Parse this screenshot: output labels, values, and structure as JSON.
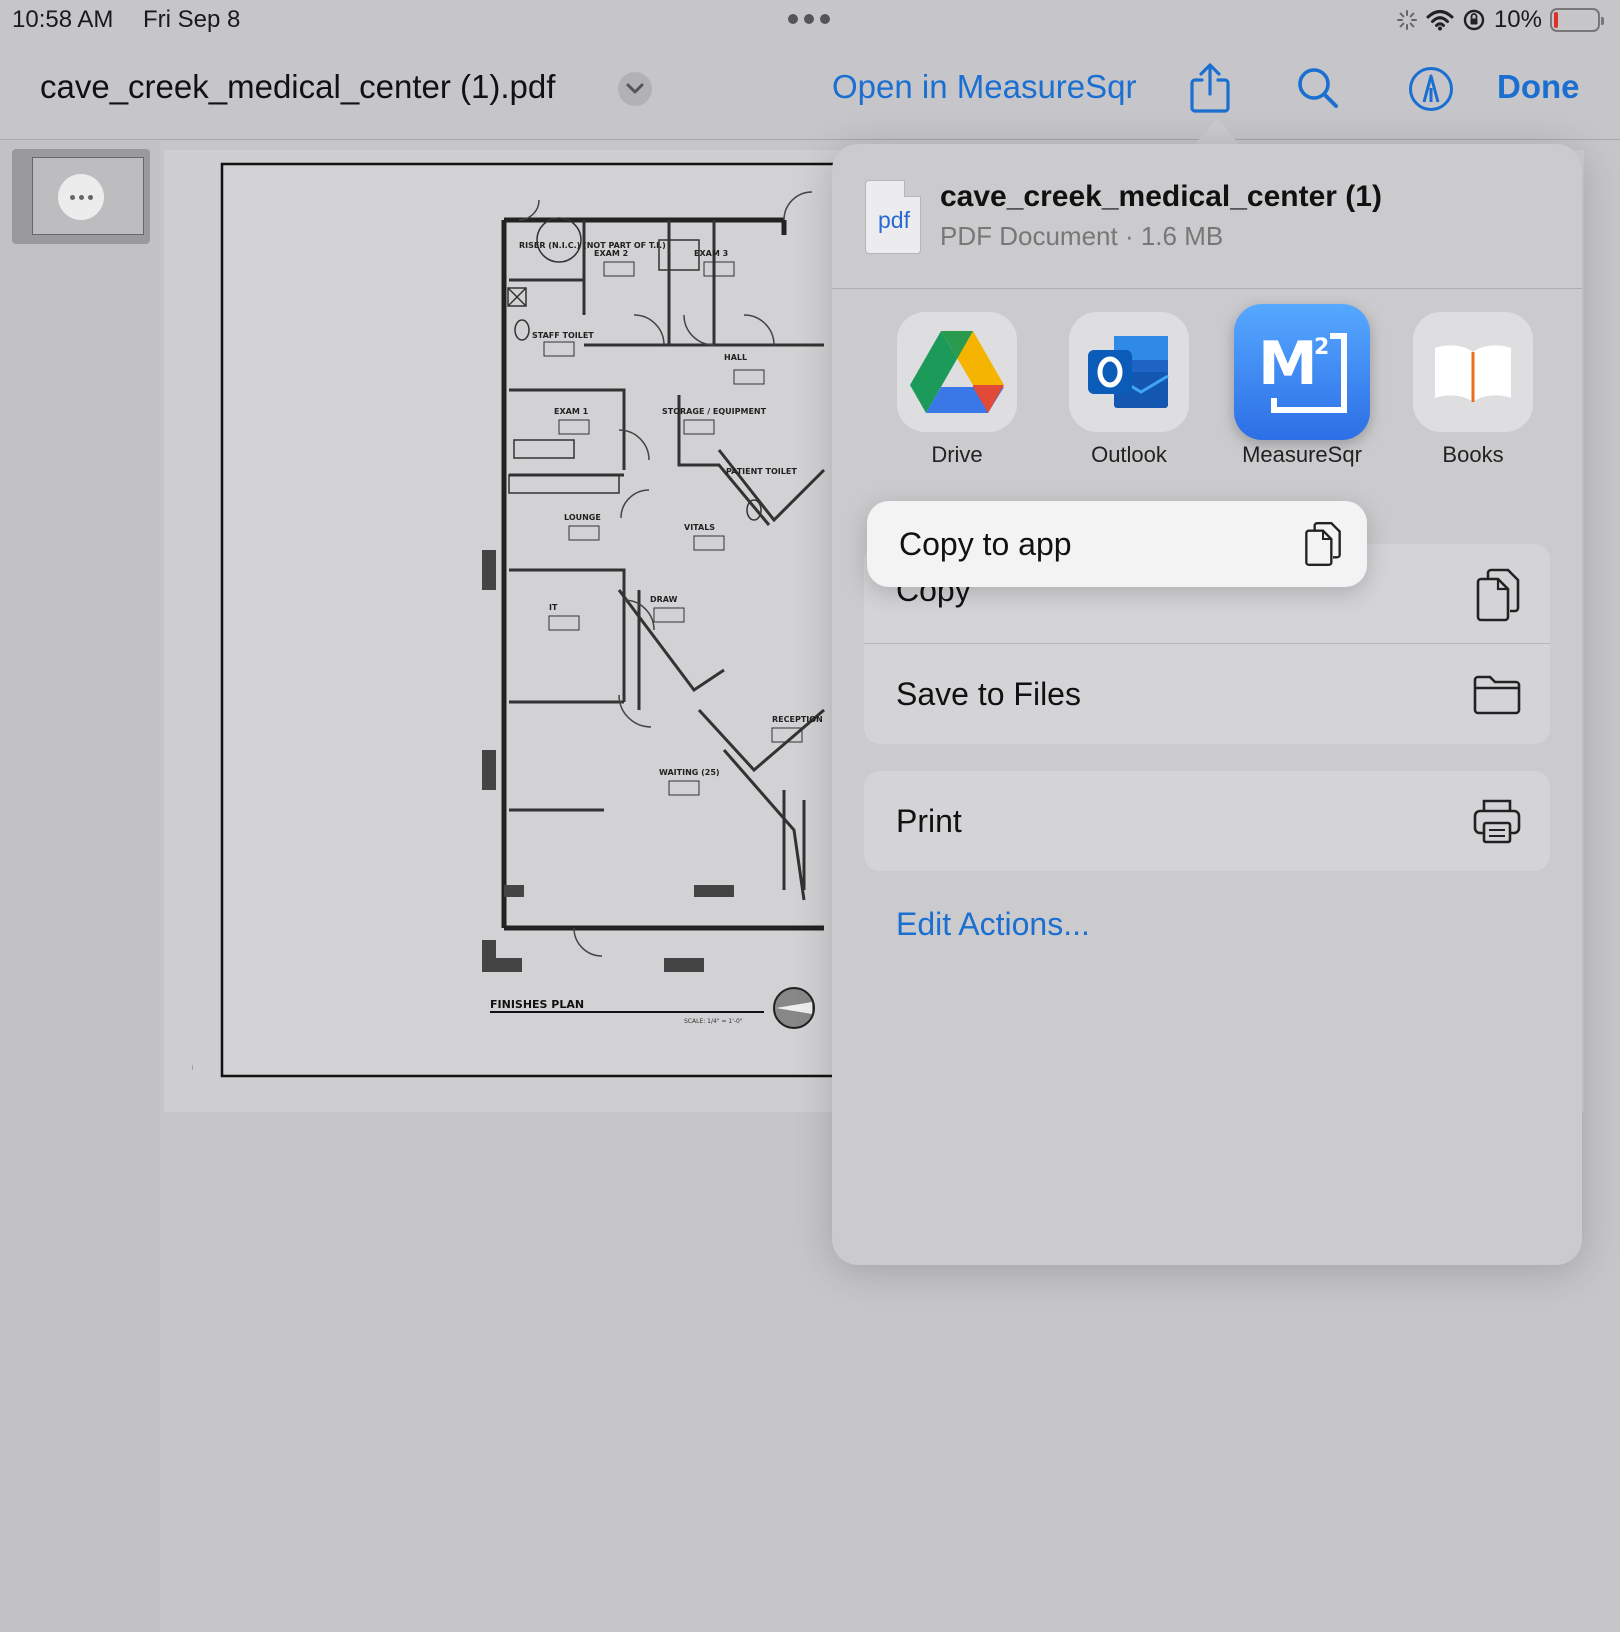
{
  "status_bar": {
    "time": "10:58 AM",
    "date": "Fri Sep 8",
    "battery": "10%",
    "battery_level": 0.1
  },
  "toolbar": {
    "document_title": "cave_creek_medical_center (1).pdf",
    "open_in_label": "Open in MeasureSqr",
    "done_label": "Done",
    "icons": [
      "share-icon",
      "search-icon",
      "markup-icon"
    ]
  },
  "drawing": {
    "rooms": [
      "RISER (N.I.C.) (NOT PART OF T.I.)",
      "EXAM 2",
      "EXAM 3",
      "STAFF TOILET",
      "EXAM 1",
      "STORAGE / EQUIPMENT",
      "HALL",
      "PATIENT TOILET",
      "LOUNGE",
      "VITALS",
      "IT",
      "DRAW",
      "RECEPTION",
      "WAITING (25)"
    ],
    "plan_title": "FINISHES PLAN",
    "scale": "SCALE: 1/4\" = 1'-0\""
  },
  "share_sheet": {
    "file_name": "cave_creek_medical_center (1)",
    "file_meta": "PDF Document · 1.6 MB",
    "file_type": "pdf",
    "apps": [
      {
        "label": "Drive"
      },
      {
        "label": "Outlook"
      },
      {
        "label": "MeasureSqr"
      },
      {
        "label": "Books"
      }
    ],
    "highlight_action": "Copy to app",
    "actions_group1": [
      "Copy",
      "Save to Files"
    ],
    "actions_group2": [
      "Print"
    ],
    "edit_actions": "Edit Actions..."
  },
  "colors": {
    "accent": "#1a6fd0",
    "background": "#c6c6ca",
    "sheet": "#cbcbce"
  }
}
